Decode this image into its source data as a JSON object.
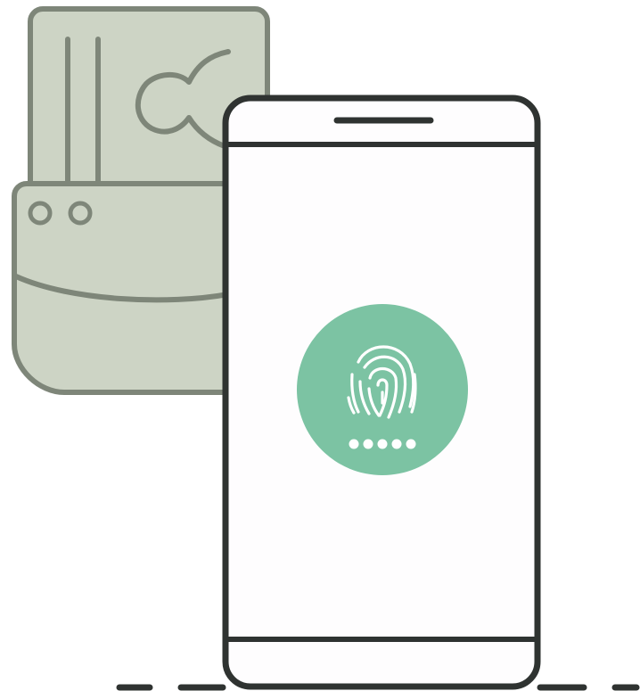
{
  "illustration": {
    "subject": "phone-fingerprint-unlock",
    "colors": {
      "outline": "#2f3331",
      "card_fill": "#cdd4c5",
      "card_stroke": "#7e8679",
      "screen_fill": "#fefdfe",
      "accent": "#7cc3a3",
      "icon_white": "#ffffff"
    },
    "icons": {
      "card": "sim-card-icon",
      "fingerprint": "fingerprint-icon",
      "pin": "pin-dots-icon"
    },
    "pin_dot_count": 5
  }
}
